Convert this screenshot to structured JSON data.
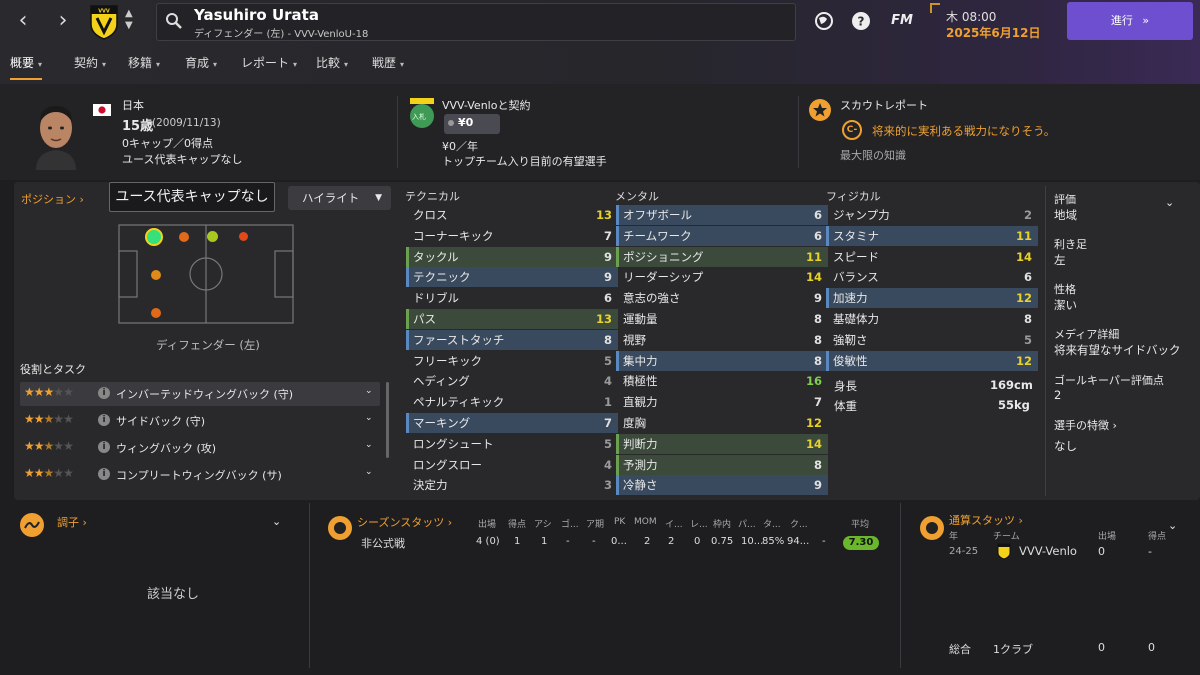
{
  "header": {
    "player_name": "Yasuhiro Urata",
    "player_subtitle": "ディフェンダー (左) - VVV-VenloU-18",
    "club_crest_text": "VVV VENLO",
    "day_time": "木 08:00",
    "date": "2025年6月12日",
    "continue_label": "進行",
    "fm_label": "FM",
    "accent": "#6d4fcf"
  },
  "tabs": [
    "概要",
    "契約",
    "移籍",
    "育成",
    "レポート",
    "比較",
    "戦歴"
  ],
  "profile": {
    "nationality": "日本",
    "age": "15歳",
    "dob": "(2009/11/13)",
    "caps": "0キャップ／0得点",
    "youth_caps": "ユース代表キャップなし"
  },
  "contract": {
    "title": "VVV-Venloと契約",
    "badge_text": "入札",
    "value": "¥0",
    "wage": "¥0／年",
    "status": "トップチーム入り目前の有望選手"
  },
  "scout": {
    "title": "スカウトレポート",
    "grade": "C-",
    "comment": "将来的に実利ある戦力になりそう。",
    "knowledge": "最大限の知識"
  },
  "position_panel": {
    "title": "ポジション",
    "dropdown": "ユース代表キャップなし",
    "highlight": "ハイライト",
    "position_label": "ディフェンダー (左)",
    "roles_title": "役割とタスク",
    "roles": [
      {
        "name": "インバーテッドウィングバック (守)",
        "stars": 3
      },
      {
        "name": "サイドバック (守)",
        "stars": 2.5
      },
      {
        "name": "ウィングバック (攻)",
        "stars": 2.5
      },
      {
        "name": "コンプリートウィングバック (サ)",
        "stars": 2.5
      }
    ]
  },
  "technical": {
    "title": "テクニカル",
    "rows": [
      {
        "n": "クロス",
        "v": "13",
        "c": "yellow",
        "h": ""
      },
      {
        "n": "コーナーキック",
        "v": "7",
        "c": "white",
        "h": ""
      },
      {
        "n": "タックル",
        "v": "9",
        "c": "white",
        "h": "g"
      },
      {
        "n": "テクニック",
        "v": "9",
        "c": "white",
        "h": "b"
      },
      {
        "n": "ドリブル",
        "v": "6",
        "c": "white",
        "h": ""
      },
      {
        "n": "パス",
        "v": "13",
        "c": "yellow",
        "h": "g"
      },
      {
        "n": "ファーストタッチ",
        "v": "8",
        "c": "white",
        "h": "b"
      },
      {
        "n": "フリーキック",
        "v": "5",
        "c": "grey",
        "h": ""
      },
      {
        "n": "ヘディング",
        "v": "4",
        "c": "grey",
        "h": ""
      },
      {
        "n": "ペナルティキック",
        "v": "1",
        "c": "grey",
        "h": ""
      },
      {
        "n": "マーキング",
        "v": "7",
        "c": "white",
        "h": "b"
      },
      {
        "n": "ロングシュート",
        "v": "5",
        "c": "grey",
        "h": ""
      },
      {
        "n": "ロングスロー",
        "v": "4",
        "c": "grey",
        "h": ""
      },
      {
        "n": "決定力",
        "v": "3",
        "c": "grey",
        "h": ""
      }
    ]
  },
  "mental": {
    "title": "メンタル",
    "rows": [
      {
        "n": "オフザボール",
        "v": "6",
        "c": "white",
        "h": "b"
      },
      {
        "n": "チームワーク",
        "v": "6",
        "c": "white",
        "h": "b"
      },
      {
        "n": "ポジショニング",
        "v": "11",
        "c": "yellow",
        "h": "g"
      },
      {
        "n": "リーダーシップ",
        "v": "14",
        "c": "yellow",
        "h": ""
      },
      {
        "n": "意志の強さ",
        "v": "9",
        "c": "white",
        "h": ""
      },
      {
        "n": "運動量",
        "v": "8",
        "c": "white",
        "h": ""
      },
      {
        "n": "視野",
        "v": "8",
        "c": "white",
        "h": ""
      },
      {
        "n": "集中力",
        "v": "8",
        "c": "white",
        "h": "b"
      },
      {
        "n": "積極性",
        "v": "16",
        "c": "green",
        "h": ""
      },
      {
        "n": "直観力",
        "v": "7",
        "c": "white",
        "h": ""
      },
      {
        "n": "度胸",
        "v": "12",
        "c": "yellow",
        "h": ""
      },
      {
        "n": "判断力",
        "v": "14",
        "c": "yellow",
        "h": "g"
      },
      {
        "n": "予測力",
        "v": "8",
        "c": "white",
        "h": "g"
      },
      {
        "n": "冷静さ",
        "v": "9",
        "c": "white",
        "h": "b"
      }
    ]
  },
  "physical": {
    "title": "フィジカル",
    "rows": [
      {
        "n": "ジャンプ力",
        "v": "2",
        "c": "grey",
        "h": ""
      },
      {
        "n": "スタミナ",
        "v": "11",
        "c": "yellow",
        "h": "b"
      },
      {
        "n": "スピード",
        "v": "14",
        "c": "yellow",
        "h": ""
      },
      {
        "n": "バランス",
        "v": "6",
        "c": "white",
        "h": ""
      },
      {
        "n": "加速力",
        "v": "12",
        "c": "yellow",
        "h": "b"
      },
      {
        "n": "基礎体力",
        "v": "8",
        "c": "white",
        "h": ""
      },
      {
        "n": "強靭さ",
        "v": "5",
        "c": "grey",
        "h": ""
      },
      {
        "n": "俊敏性",
        "v": "12",
        "c": "yellow",
        "h": "b"
      }
    ],
    "height_label": "身長",
    "height": "169cm",
    "weight_label": "体重",
    "weight": "55kg"
  },
  "right_panel": {
    "rating_label": "評価",
    "rating_value": "地域",
    "foot_label": "利き足",
    "foot_value": "左",
    "personality_label": "性格",
    "personality_value": "潔い",
    "media_label": "メディア詳細",
    "media_value": "将来有望なサイドバック",
    "gk_label": "ゴールキーパー評価点",
    "gk_value": "2",
    "traits_label": "選手の特徴",
    "traits_value": "なし"
  },
  "form": {
    "title": "調子",
    "empty": "該当なし"
  },
  "season_stats": {
    "title": "シーズンスタッツ",
    "headers": [
      "出場",
      "得点",
      "アシ",
      "ゴ...",
      "ア期",
      "PK",
      "MOM",
      "イ...",
      "レ...",
      "枠内",
      "パ...",
      "タ...",
      "ク...",
      "平均"
    ],
    "row_label": "非公式戦",
    "values": [
      "4 (0)",
      "1",
      "1",
      "-",
      "-",
      "0...",
      "2",
      "2",
      "0",
      "0.75",
      "10...",
      "85%",
      "94...",
      "-"
    ],
    "rating": "7.30"
  },
  "career_stats": {
    "title": "通算スタッツ",
    "col_year": "年",
    "col_team": "チーム",
    "col_apps": "出場",
    "col_goals": "得点",
    "year": "24-25",
    "team": "VVV-Venlo",
    "apps": "0",
    "goals": "-",
    "total_label": "総合",
    "total_clubs": "1クラブ",
    "total_apps": "0",
    "total_goals": "0"
  }
}
